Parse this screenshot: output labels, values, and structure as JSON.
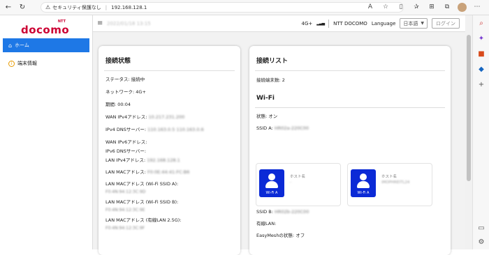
{
  "browser": {
    "security_label": "セキュリティ保護なし",
    "url": "192.168.128.1"
  },
  "sidebar": {
    "brand_small": "NTT",
    "brand": "docomo",
    "items": [
      {
        "label": "ホーム",
        "icon": "home-icon",
        "active": true
      },
      {
        "label": "端末情報",
        "icon": "info-icon",
        "active": false
      }
    ]
  },
  "topbar": {
    "datetime": "2022/01/18 13:15",
    "network": "4G+",
    "carrier": "NTT DOCOMO",
    "language_label": "Language",
    "language_value": "日本語",
    "login_label": "ログイン"
  },
  "connection_status": {
    "title": "接続状態",
    "rows": [
      {
        "label": "ステータス:",
        "value": "接続中",
        "blurred": false
      },
      {
        "label": "ネットワーク:",
        "value": "4G+",
        "blurred": false
      },
      {
        "label": "期間:",
        "value": "00:04",
        "blurred": false
      },
      {
        "label": "WAN IPv4アドレス:",
        "value": "10.217.231.200",
        "blurred": true
      },
      {
        "label": "IPv4 DNSサーバー:",
        "value": "110.163.0.5 110.163.0.6",
        "blurred": true
      },
      {
        "label": "WAN IPv6アドレス:",
        "value": "",
        "blurred": false
      },
      {
        "label": "IPv6 DNSサーバー:",
        "value": "",
        "blurred": false
      },
      {
        "label": "LAN IPv4アドレス:",
        "value": "192.168.128.1",
        "blurred": true
      },
      {
        "label": "LAN MACアドレス:",
        "value": "F0:0E:44:41:FC:B6",
        "blurred": true
      }
    ],
    "rows_sub": [
      {
        "label": "LAN MACアドレス (Wi-Fi SSID A):",
        "value": "F0:4N:94:12:3C:9D"
      },
      {
        "label": "LAN MACアドレス (Wi-Fi SSID B):",
        "value": "F0:4N:94:12:3C:9E"
      },
      {
        "label": "LAN MACアドレス (有線LAN 2.5G):",
        "value": "F0:4N:94:12:3C:9F"
      }
    ]
  },
  "connection_list": {
    "title": "接続リスト",
    "device_count_label": "接続端末数:",
    "device_count": "2",
    "wifi": {
      "title": "Wi-Fi",
      "state_label": "状態:",
      "state_value": "オン",
      "ssid_a_label": "SSID A:",
      "ssid_a_value": "HR02a-220C00",
      "ssid_b_label": "SSID B:",
      "ssid_b_value": "HR02b-220C00",
      "devices": [
        {
          "tile_label": "Wi-Fi A",
          "host_label": "ホスト名",
          "host_value": "-"
        },
        {
          "tile_label": "Wi-Fi A",
          "host_label": "ホスト名",
          "host_value": "iMOPHREITL24"
        }
      ]
    },
    "wired_label": "有線LAN:",
    "easymesh_label": "EasyMeshの状態:",
    "easymesh_value": "オフ"
  },
  "colors": {
    "brand": "#cc0033",
    "nav_active": "#1e78e6",
    "device_tile": "#0b2ad6"
  }
}
